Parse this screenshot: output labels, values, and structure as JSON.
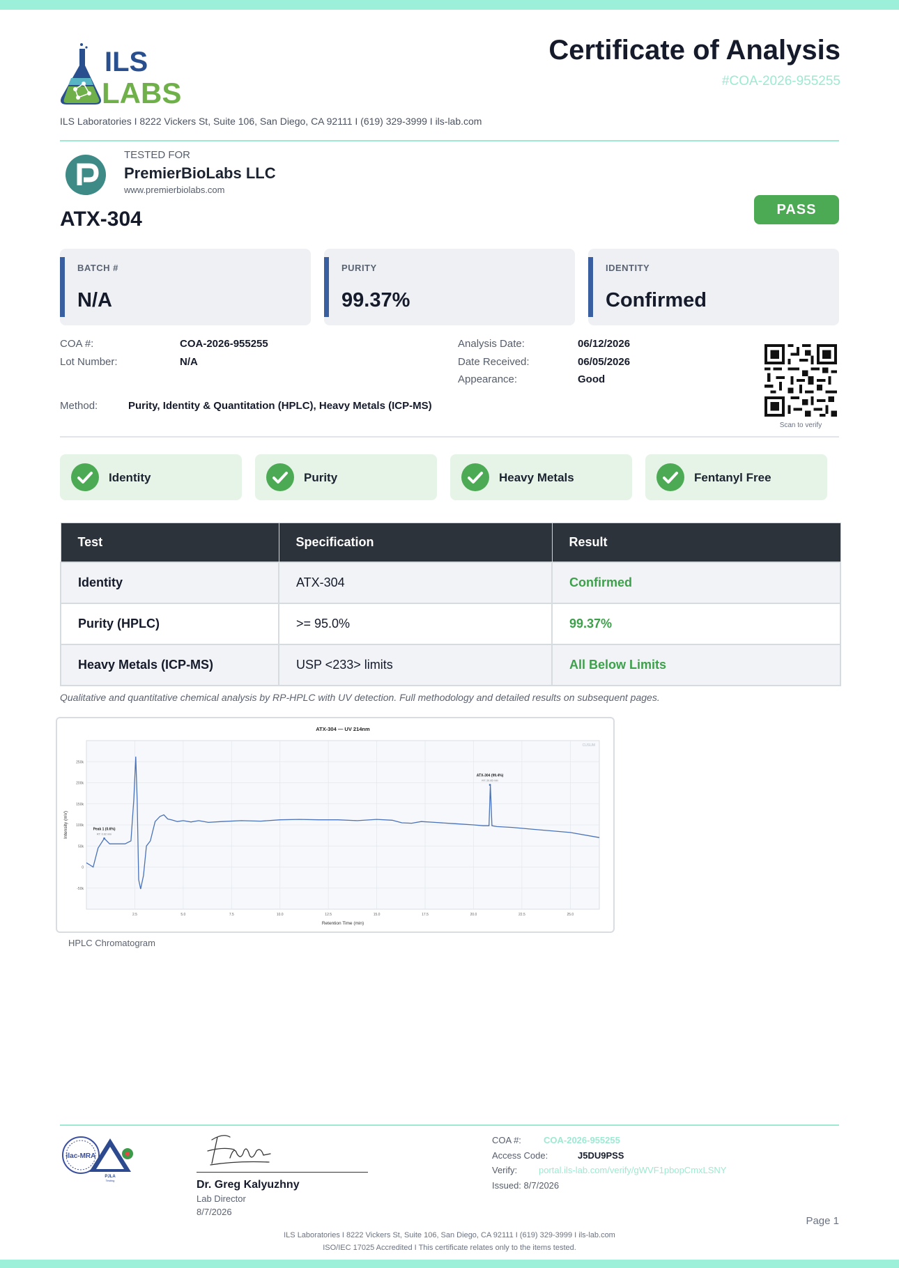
{
  "header": {
    "brand_top": "ILS",
    "brand_bottom": "LABS",
    "title": "Certificate of Analysis",
    "doc_number": "#COA-2026-955255",
    "address_line": "ILS Laboratories  I  8222 Vickers St, Suite 106, San Diego, CA 92111  I  (619) 329-3999  I  ils-lab.com"
  },
  "client": {
    "tested_for_label": "TESTED FOR",
    "name": "PremierBioLabs LLC",
    "website": "www.premierbiolabs.com"
  },
  "product": {
    "name": "ATX-304",
    "status": "PASS"
  },
  "summary_cards": [
    {
      "label": "BATCH #",
      "value": "N/A"
    },
    {
      "label": "PURITY",
      "value": "99.37%"
    },
    {
      "label": "IDENTITY",
      "value": "Confirmed"
    }
  ],
  "details": {
    "coa_label": "COA #:",
    "coa_value": "COA-2026-955255",
    "lot_label": "Lot Number:",
    "lot_value": "N/A",
    "analysis_label": "Analysis Date:",
    "analysis_value": "06/12/2026",
    "received_label": "Date Received:",
    "received_value": "06/05/2026",
    "appearance_label": "Appearance:",
    "appearance_value": "Good",
    "method_label": "Method:",
    "method_value": "Purity, Identity & Quantitation (HPLC), Heavy Metals (ICP-MS)",
    "qr_caption": "Scan to verify"
  },
  "checks": [
    "Identity",
    "Purity",
    "Heavy Metals",
    "Fentanyl Free"
  ],
  "results_table": {
    "headers": [
      "Test",
      "Specification",
      "Result"
    ],
    "rows": [
      {
        "test": "Identity",
        "spec": "ATX-304",
        "result": "Confirmed"
      },
      {
        "test": "Purity (HPLC)",
        "spec": ">= 95.0%",
        "result": "99.37%"
      },
      {
        "test": "Heavy Metals (ICP-MS)",
        "spec": "USP <233> limits",
        "result": "All Below Limits"
      }
    ]
  },
  "note": "Qualitative and quantitative chemical analysis by RP-HPLC with UV detection. Full methodology and detailed results on subsequent pages.",
  "chart_data": {
    "type": "line",
    "title": "ATX-304 — UV 214nm",
    "xlabel": "Retention Time (min)",
    "ylabel": "Intensity (mV)",
    "xlim": [
      0,
      26.5
    ],
    "ylim": [
      -100,
      300
    ],
    "x_ticks": [
      "2.5",
      "5.0",
      "7.5",
      "10.0",
      "12.5",
      "15.0",
      "17.5",
      "20.0",
      "22.5",
      "25.0"
    ],
    "y_ticks": [
      "-50k",
      "0",
      "50k",
      "100k",
      "150k",
      "200k",
      "250k"
    ],
    "annotations": [
      {
        "text": "Peak 1 (0.6%)",
        "sub": "RT: 0.92 min",
        "x": 0.92,
        "y": 68
      },
      {
        "text": "ATX-304 (99.4%)",
        "sub": "RT: 20.85 min",
        "x": 20.85,
        "y": 195
      }
    ],
    "corner_label": "CUSUM",
    "series": [
      {
        "color": "#4a72b8",
        "x": [
          0,
          0.35,
          0.6,
          0.92,
          1.2,
          1.6,
          2.0,
          2.3,
          2.45,
          2.55,
          2.62,
          2.7,
          2.8,
          2.95,
          3.1,
          3.3,
          3.55,
          3.8,
          4.0,
          4.2,
          4.4,
          4.7,
          5.0,
          5.4,
          5.8,
          6.3,
          7.0,
          8.0,
          9.0,
          10.0,
          11.0,
          12.0,
          13.0,
          14.0,
          15.0,
          15.8,
          16.3,
          16.8,
          17.3,
          18.0,
          19.0,
          20.0,
          20.5,
          20.8,
          20.87,
          20.95,
          21.2,
          22.0,
          23.0,
          24.0,
          25.0,
          26.5
        ],
        "y": [
          10,
          0,
          45,
          68,
          55,
          55,
          55,
          62,
          160,
          262,
          160,
          -30,
          -52,
          -20,
          50,
          62,
          108,
          120,
          124,
          114,
          112,
          108,
          110,
          107,
          110,
          106,
          108,
          110,
          109,
          112,
          113,
          112,
          112,
          110,
          113,
          111,
          105,
          104,
          108,
          106,
          103,
          100,
          98,
          98,
          195,
          98,
          96,
          94,
          90,
          86,
          82,
          70
        ]
      }
    ]
  },
  "chart_caption": "HPLC Chromatogram",
  "signatory": {
    "name": "Dr. Greg Kalyuzhny",
    "role": "Lab Director",
    "date": "8/7/2026"
  },
  "seals": {
    "ilac": "ilac-MRA",
    "pjla": "PJLA",
    "pjla_sub": "Testing"
  },
  "footer_info": {
    "coa_label": "COA #:",
    "coa_value": "COA-2026-955255",
    "access_label": "Access Code:",
    "access_value": "J5DU9PSS",
    "verify_label": "Verify:",
    "verify_value": "portal.ils-lab.com/verify/gWVF1pbopCmxLSNY",
    "issued": "Issued: 8/7/2026",
    "page": "Page 1"
  },
  "footer": {
    "line1": "ILS Laboratories  I  8222 Vickers St, Suite 106, San Diego, CA 92111  I  (619) 329-3999  I  ils-lab.com",
    "line2": "ISO/IEC 17025 Accredited  I  This certificate relates only to the items tested."
  },
  "colors": {
    "accent_teal": "#9cefd8",
    "pass_green": "#4caa54",
    "card_blue": "#3a5fa0",
    "header_dark": "#2d333b"
  }
}
